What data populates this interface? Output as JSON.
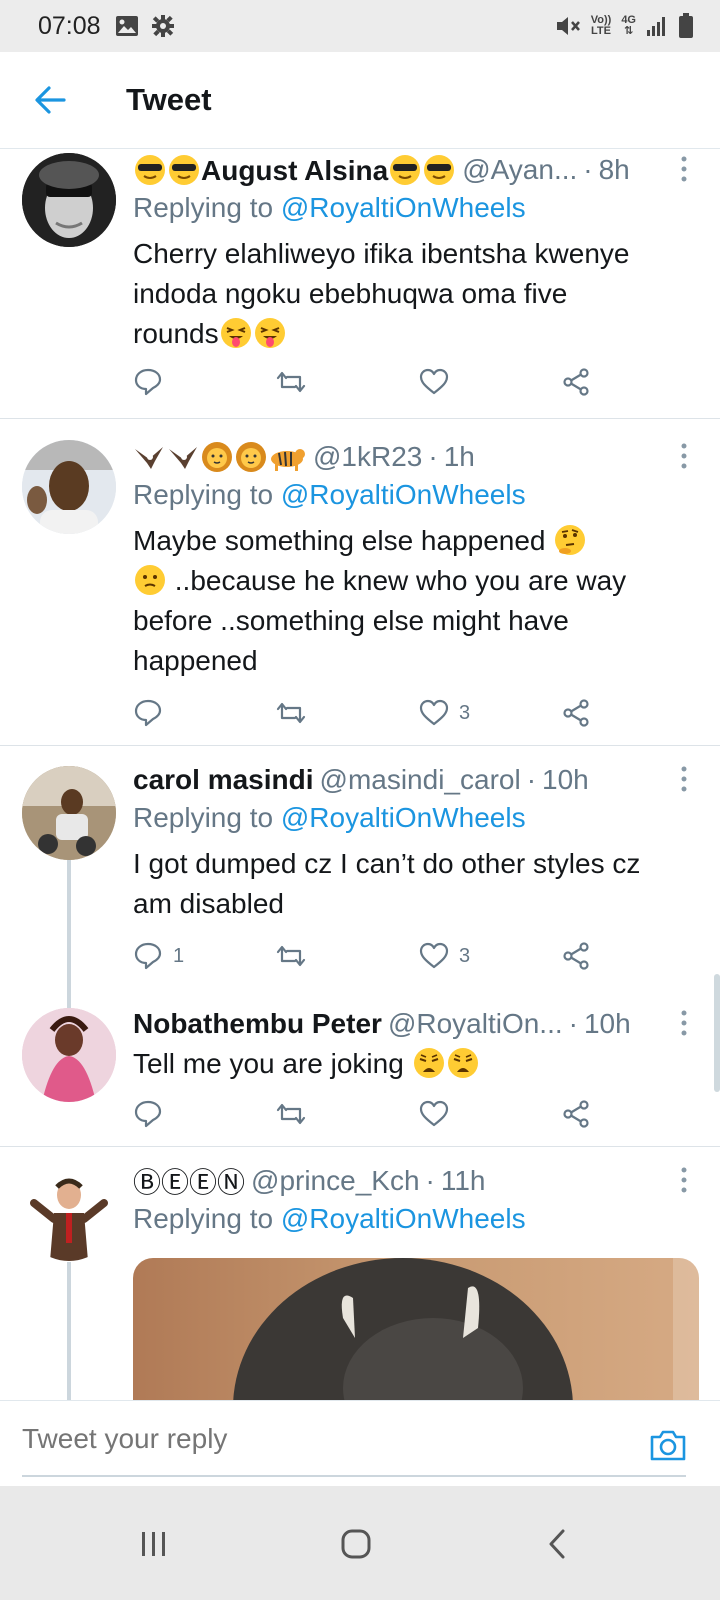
{
  "status_bar": {
    "time": "07:08",
    "network_top": "Vo))",
    "network_bottom": "LTE",
    "data_type": "4G"
  },
  "header": {
    "title": "Tweet"
  },
  "tweets": [
    {
      "name": "August Alsina",
      "handle": "@Ayan...",
      "time": "8h",
      "replying_prefix": "Replying to ",
      "replying_to": "@RoyaltiOnWheels",
      "body_lines": [
        "Cherry elahliweyo ifika ibentsha kwenye",
        "indoda ngoku ebebhuqwa oma five",
        "rounds"
      ],
      "reply_count": "",
      "like_count": ""
    },
    {
      "name": "",
      "handle": "@1kR23",
      "time": "1h",
      "replying_prefix": "Replying to ",
      "replying_to": "@RoyaltiOnWheels",
      "body_lines": [
        "Maybe something else happened",
        "..because he knew who you are way",
        "before ..something else might have",
        "happened"
      ],
      "reply_count": "",
      "like_count": "3"
    },
    {
      "name": "carol masindi",
      "handle": "@masindi_carol",
      "time": "10h",
      "replying_prefix": "Replying to ",
      "replying_to": "@RoyaltiOnWheels",
      "body_lines": [
        "I got dumped cz I can’t do other styles cz",
        "am disabled"
      ],
      "reply_count": "1",
      "like_count": "3"
    },
    {
      "name": "Nobathembu Peter",
      "handle": "@RoyaltiOn...",
      "time": "10h",
      "body_lines": [
        "Tell me you are joking"
      ],
      "reply_count": "",
      "like_count": ""
    },
    {
      "name": "ⒷⒺⒺⓃ",
      "handle": "@prince_Kch",
      "time": "11h",
      "replying_prefix": "Replying to ",
      "replying_to": "@RoyaltiOnWheels"
    }
  ],
  "reply_bar": {
    "placeholder": "Tweet your reply"
  },
  "icons": {
    "back": "arrow-left-icon",
    "reply": "comment-icon",
    "retweet": "retweet-icon",
    "like": "heart-icon",
    "share": "share-icon",
    "camera": "camera-icon",
    "more": "kebab-menu-icon"
  },
  "colors": {
    "accent": "#1b95e0",
    "secondary_text": "#657786",
    "primary_text": "#14171a"
  }
}
